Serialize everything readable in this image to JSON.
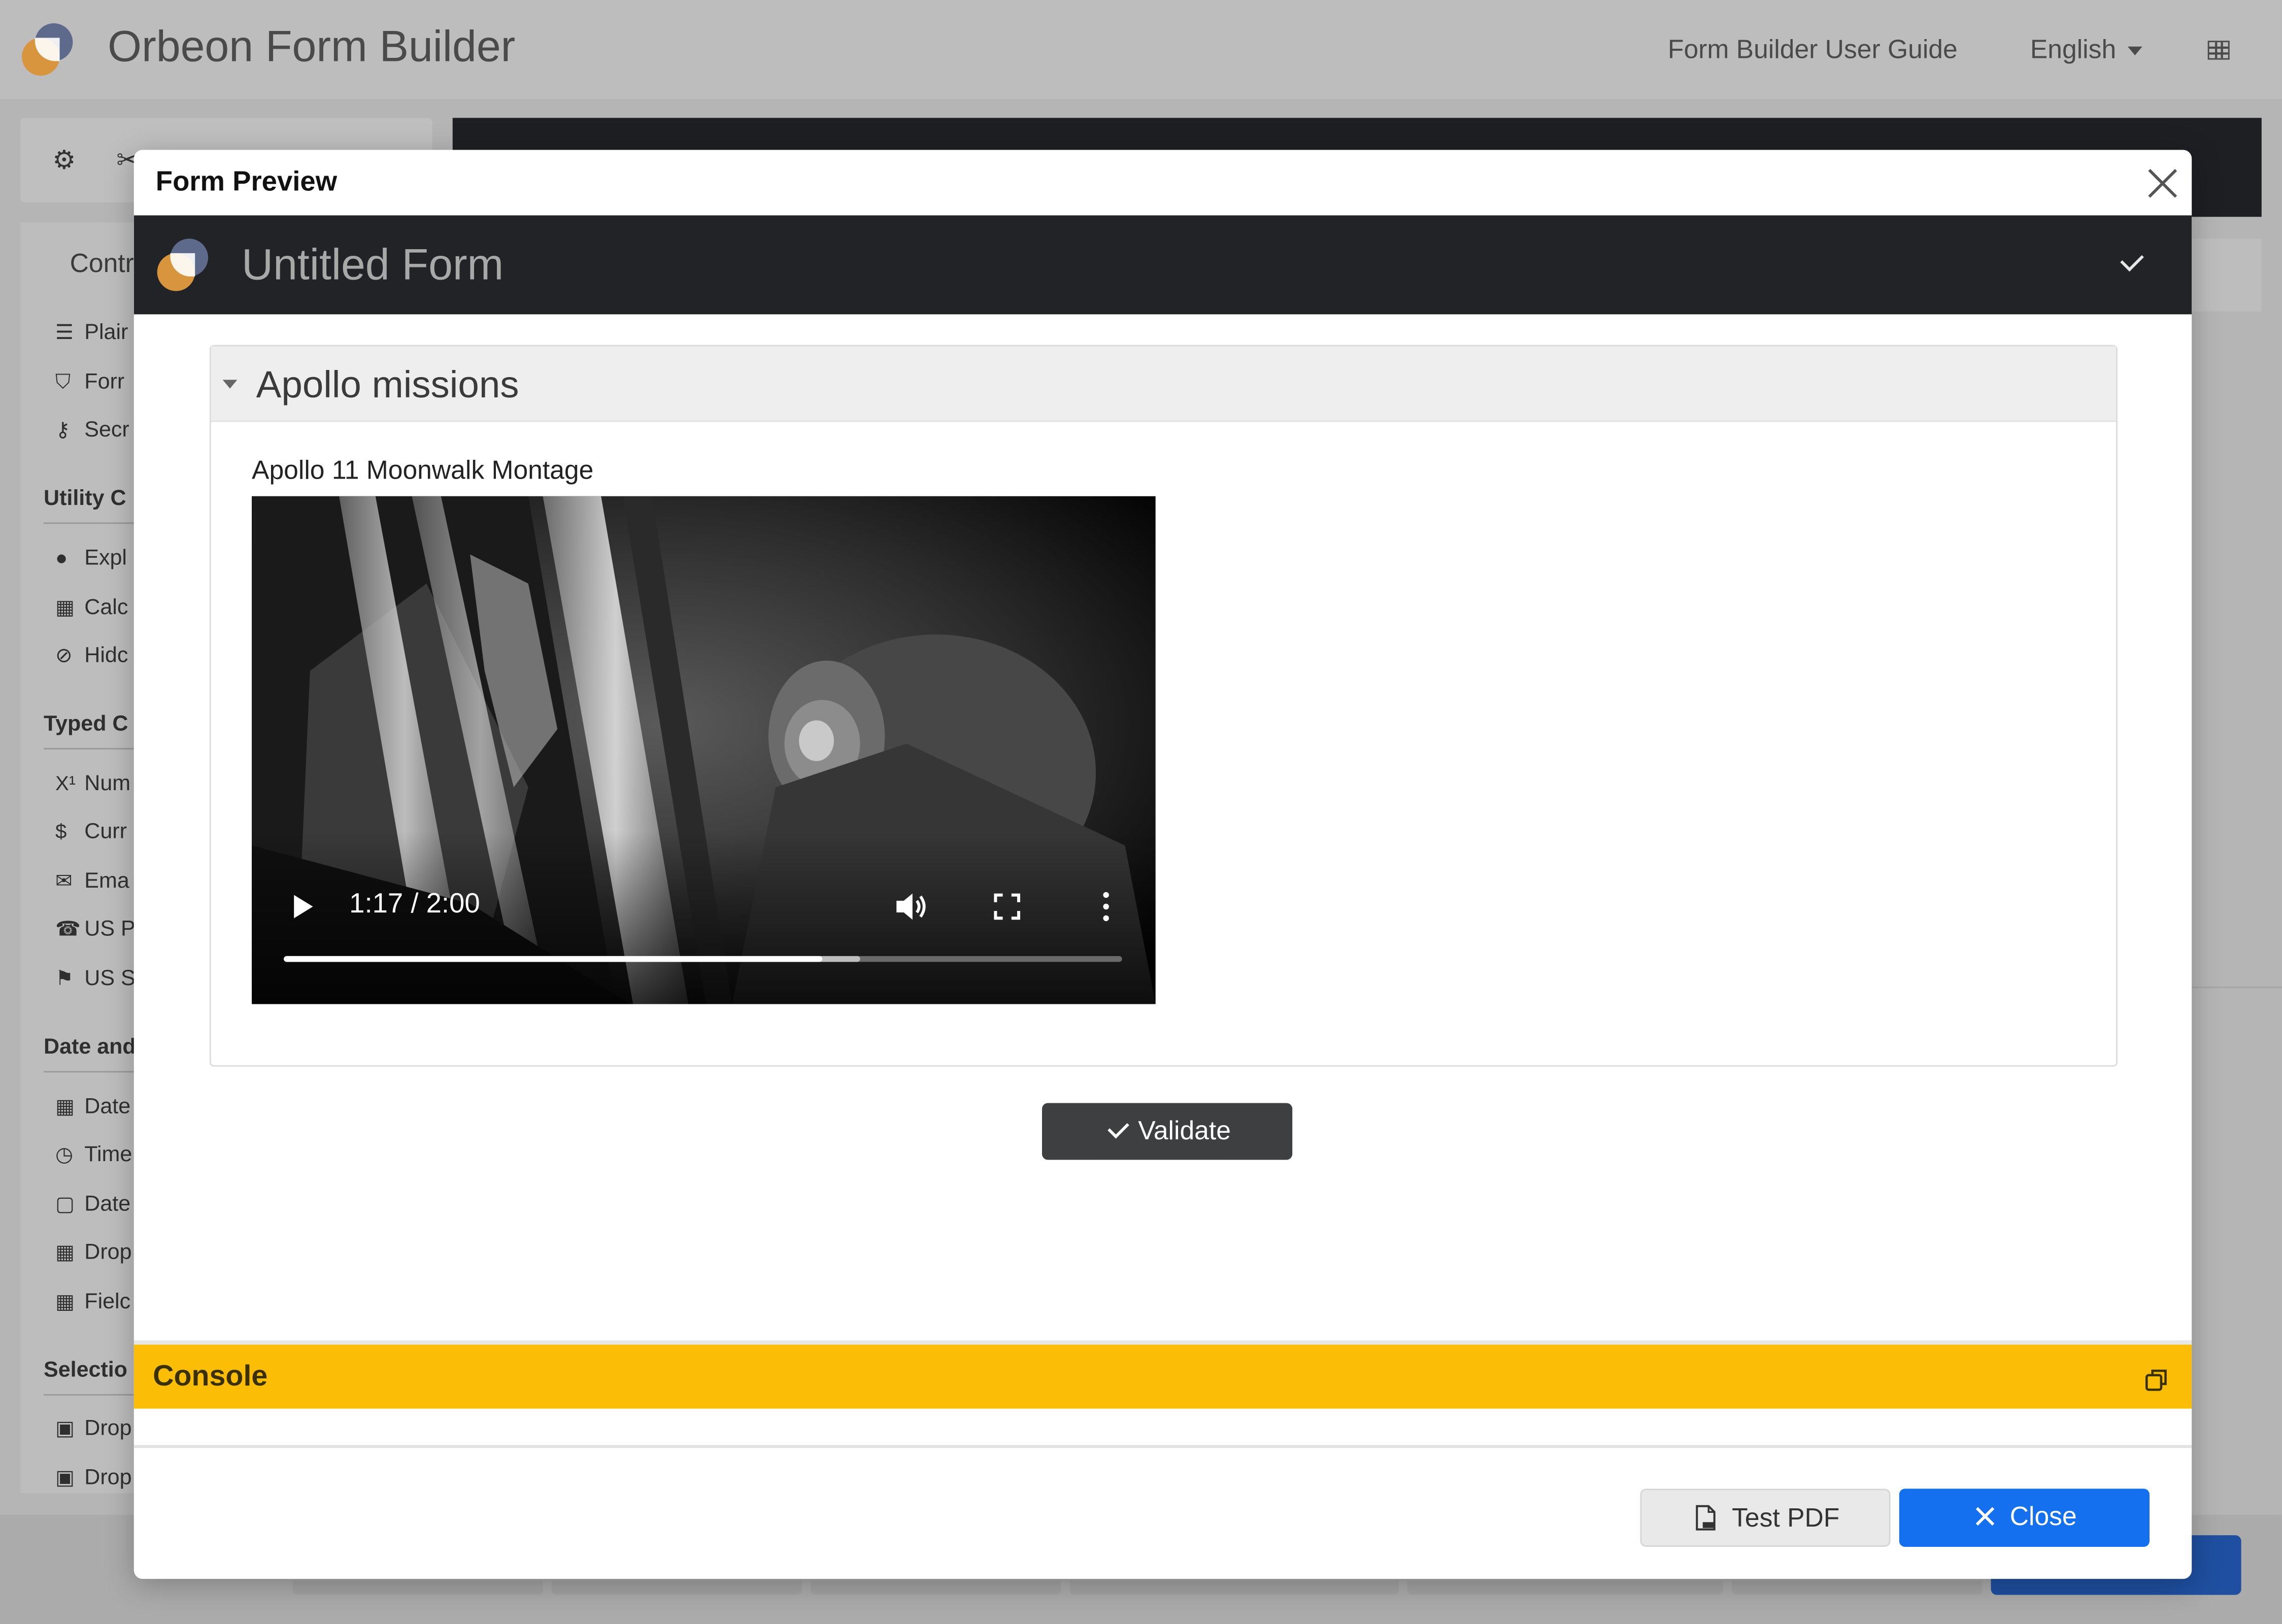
{
  "app": {
    "title": "Orbeon Form Builder",
    "user_guide_link": "Form Builder User Guide",
    "language": "English"
  },
  "sidebar": {
    "heading": "Contr",
    "basic_items": [
      {
        "icon": "paragraph-icon",
        "label": "Plair"
      },
      {
        "icon": "html5-icon",
        "label": "Forr"
      },
      {
        "icon": "key-icon",
        "label": "Secr"
      }
    ],
    "categories": [
      {
        "label": "Utility C",
        "items": [
          {
            "icon": "comment-icon",
            "label": "Expl"
          },
          {
            "icon": "calculator-icon",
            "label": "Calc"
          },
          {
            "icon": "eye-slash-icon",
            "label": "Hidc"
          }
        ]
      },
      {
        "label": "Typed C",
        "items": [
          {
            "icon": "superscript-icon",
            "label": "Num"
          },
          {
            "icon": "dollar-icon",
            "label": "Curr"
          },
          {
            "icon": "envelope-icon",
            "label": "Ema"
          },
          {
            "icon": "phone-icon",
            "label": "US P"
          },
          {
            "icon": "flag-icon",
            "label": "US S"
          }
        ]
      },
      {
        "label": "Date and",
        "items": [
          {
            "icon": "calendar-icon",
            "label": "Date"
          },
          {
            "icon": "clock-icon",
            "label": "Time"
          },
          {
            "icon": "calendar-outline-icon",
            "label": "Date"
          },
          {
            "icon": "calendar-icon",
            "label": "Drop"
          },
          {
            "icon": "calendar-icon",
            "label": "Fielc"
          }
        ]
      },
      {
        "label": "Selectio",
        "items": [
          {
            "icon": "caret-square-icon",
            "label": "Drop"
          },
          {
            "icon": "caret-square-icon",
            "label": "Drop"
          }
        ]
      }
    ]
  },
  "modal": {
    "title": "Form Preview",
    "form_title": "Untitled Form",
    "section_title": "Apollo missions",
    "field_label": "Apollo 11 Moonwalk Montage",
    "video": {
      "time_display": "1:17 / 2:00",
      "progress_fraction": 0.642,
      "buffered_fraction": 0.688
    },
    "validate_label": "Validate",
    "console_title": "Console",
    "test_pdf_label": "Test PDF",
    "close_label": "Close"
  },
  "colors": {
    "console_bar": "#fbbd05",
    "close_button": "#1570ef",
    "form_header": "#212327",
    "validate_button": "#3e3f41",
    "logo_blue": "#5d6a8c",
    "logo_orange": "#d9953e"
  }
}
